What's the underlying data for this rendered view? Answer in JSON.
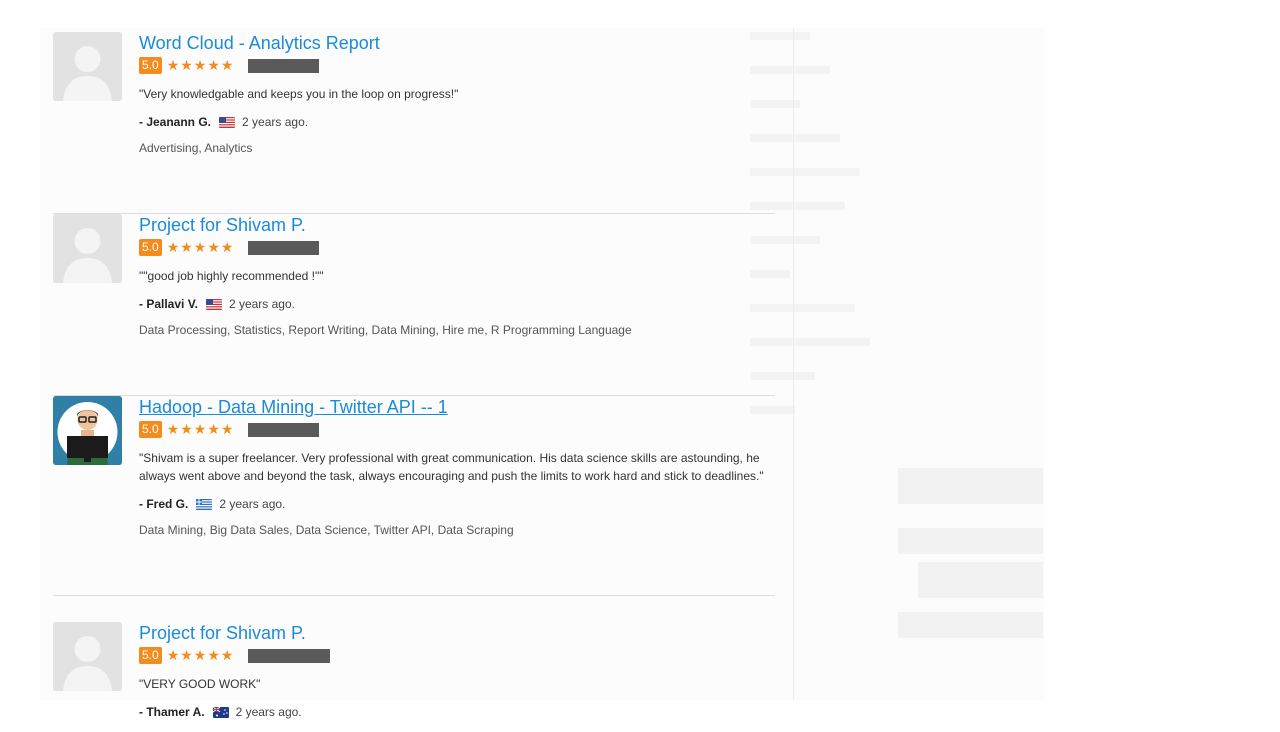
{
  "reviews": [
    {
      "title": "Word Cloud - Analytics Report",
      "title_underlined": false,
      "score": "5.0",
      "stars": "★★★★★",
      "comment": "\"Very knowledgable and keeps you in the loop on progress!\"",
      "reviewer": "- Jeanann G.",
      "flag": "us-flag-icon",
      "time": "2 years ago.",
      "tags": "Advertising, Analytics",
      "avatar": "default-avatar"
    },
    {
      "title": "Project for Shivam P.",
      "title_underlined": false,
      "score": "5.0",
      "stars": "★★★★★",
      "comment": "\"\"good job highly recommended !\"\"",
      "reviewer": "- Pallavi V.",
      "flag": "us-flag-icon",
      "time": "2 years ago.",
      "tags": "Data Processing, Statistics, Report Writing, Data Mining, Hire me, R Programming Language",
      "avatar": "default-avatar"
    },
    {
      "title": "Hadoop - Data Mining - Twitter API -- 1",
      "title_underlined": true,
      "score": "5.0",
      "stars": "★★★★★",
      "comment": "\"Shivam is a super freelancer. Very professional with great communication. His data science skills are astounding, he always went above and beyond the task, always encouraging and push the limits to work hard and stick to deadlines.\"",
      "reviewer": "- Fred G.",
      "flag": "greece-flag-icon",
      "time": "2 years ago.",
      "tags": "Data Mining, Big Data Sales, Data Science, Twitter API, Data Scraping",
      "avatar": "cartoon-avatar"
    },
    {
      "title": "Project for Shivam P.",
      "title_underlined": false,
      "score": "5.0",
      "stars": "★★★★★",
      "comment": "\"VERY GOOD WORK\"",
      "reviewer": "- Thamer A.",
      "flag": "australia-flag-icon",
      "time": "2 years ago.",
      "tags": "",
      "avatar": "default-avatar"
    }
  ],
  "colors": {
    "title_link": "#1a8bd6",
    "rating_orange": "#f48b1d",
    "redaction": "#5a5a5a"
  }
}
